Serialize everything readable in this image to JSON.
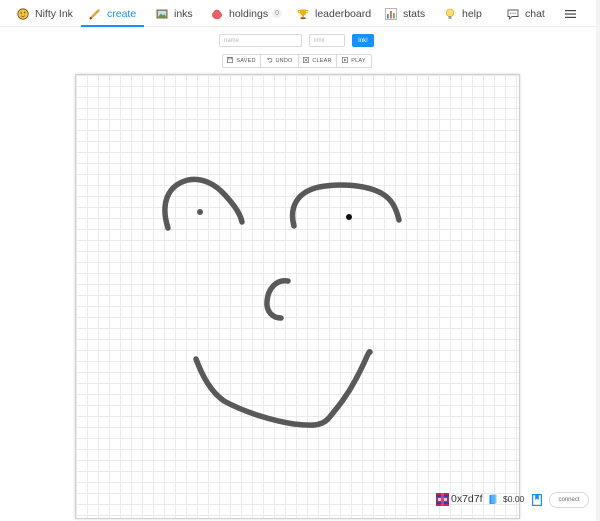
{
  "nav": {
    "brand": "Nifty Ink",
    "create": "create",
    "inks": "inks",
    "holdings": "holdings",
    "holdings_count": "0",
    "leaderboard": "leaderboard",
    "stats": "stats",
    "help": "help",
    "chat": "chat",
    "menu_icon": "hamburger-menu-icon"
  },
  "form": {
    "name_placeholder": "name",
    "limit_placeholder": "limit",
    "ink_button": "Ink!"
  },
  "toolbar": {
    "saved": "SAVED",
    "undo": "UNDO",
    "clear": "CLEAR",
    "play": "PLAY"
  },
  "footer": {
    "address": "0x7d7f",
    "balance": "$0.00",
    "connect": "connect"
  },
  "colors": {
    "accent": "#1890ff",
    "stroke": "#595959"
  }
}
